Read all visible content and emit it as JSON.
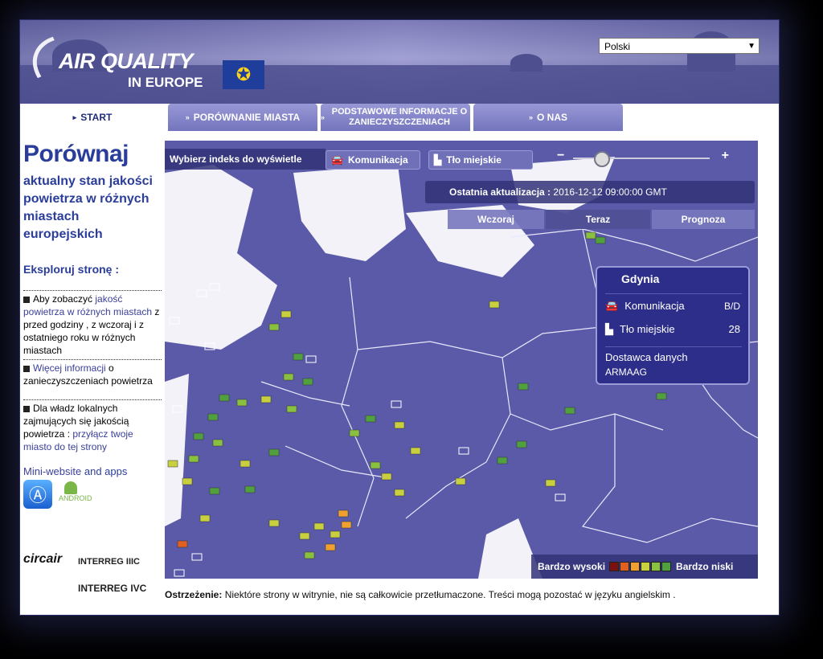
{
  "header": {
    "logo_line1": "AIR QUALITY",
    "logo_line2": "IN EUROPE",
    "language": "Polski"
  },
  "nav": {
    "tabs": [
      {
        "label": "START"
      },
      {
        "label": "PORÓWNANIE MIASTA"
      },
      {
        "label": "PODSTAWOWE INFORMACJE O ZANIECZYSZCZENIACH"
      },
      {
        "label": "O NAS"
      }
    ]
  },
  "sidebar": {
    "title": "Porównaj",
    "subtitle": "aktualny stan jakości powietrza w różnych miastach europejskich",
    "explore": "Eksploruj stronę :",
    "item1_prefix": "Aby zobaczyć",
    "item1_link": "jakość powietrza w różnych miastach",
    "item1_rest": "z przed godziny , z wczoraj i z ostatniego roku w różnych miastach",
    "item2_link": "Więcej informacji",
    "item2_rest": "o zanieczyszczeniach powietrza",
    "item3_prefix": "Dla władz lokalnych zajmujących się jakością powietrza :",
    "item3_link": "przyłącz twoje miasto do tej strony",
    "mini_website": "Mini-website",
    "and_apps": "and apps",
    "android_label": "ANDROID",
    "partner1": "circair",
    "partner2": "INTERREG IIIC",
    "partner3": "INTERREG IVC"
  },
  "map": {
    "index_prompt": "Wybierz indeks do wyświetle",
    "btn_traffic": "Komunikacja",
    "btn_background": "Tło miejskie",
    "last_update_label": "Ostatnia aktualizacja :",
    "last_update_value": "2016-12-12 09:00:00 GMT",
    "tabs": [
      "Wczoraj",
      "Teraz",
      "Prognoza"
    ],
    "active_tab": "Teraz",
    "zoom_minus": "−",
    "zoom_plus": "+",
    "legend_high": "Bardzo wysoki",
    "legend_low": "Bardzo niski",
    "legend_colors": [
      "#7a1010",
      "#e06020",
      "#f0a030",
      "#c8d040",
      "#8ac040",
      "#50a040"
    ]
  },
  "popup": {
    "city": "Gdynia",
    "traffic_label": "Komunikacja",
    "traffic_value": "B/D",
    "background_label": "Tło miejskie",
    "background_value": "28",
    "provider_label": "Dostawca danych",
    "provider_value": "ARMAAG"
  },
  "warning": {
    "label": "Ostrzeżenie:",
    "text": "Niektóre strony w witrynie, nie są całkowicie przetłumaczone. Treści mogą pozostać w języku angielskim ."
  }
}
